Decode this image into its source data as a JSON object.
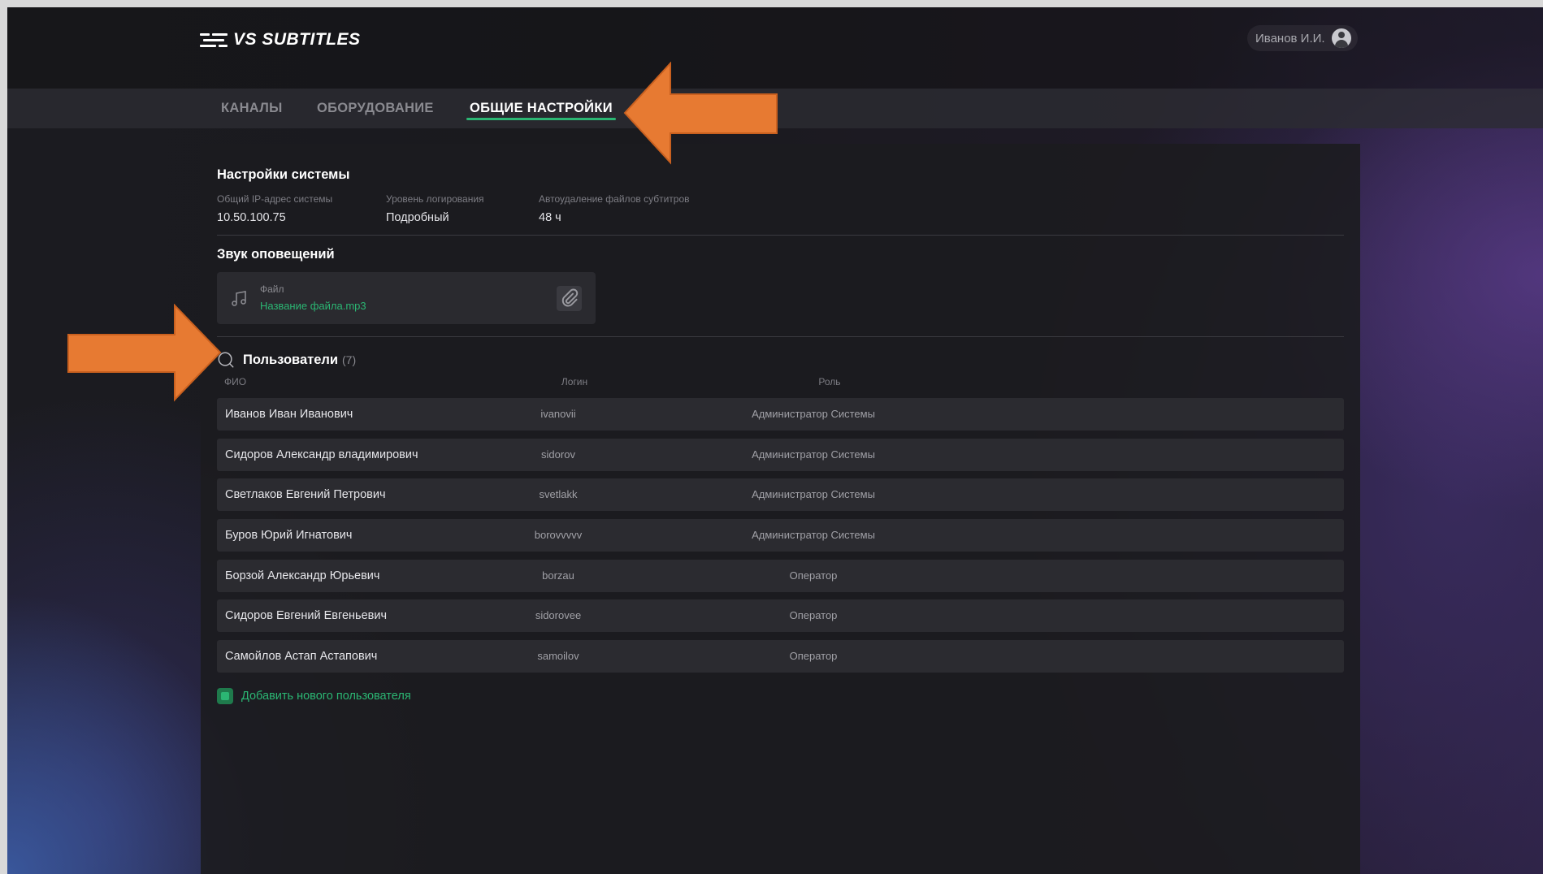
{
  "app": {
    "name": "VS SUBTITLES",
    "brand_color": "#2bb673",
    "accent_arrow_color": "#e77a32"
  },
  "header": {
    "user_name": "Иванов И.И.",
    "avatar_icon": "user-circle-icon"
  },
  "tabs": [
    {
      "label": "КАНАЛЫ",
      "active": false
    },
    {
      "label": "ОБОРУДОВАНИЕ",
      "active": false
    },
    {
      "label": "ОБЩИЕ НАСТРОЙКИ",
      "active": true
    }
  ],
  "system_settings": {
    "title": "Настройки системы",
    "fields": [
      {
        "label": "Общий IP-адрес системы",
        "value": "10.50.100.75"
      },
      {
        "label": "Уровень логирования",
        "value": "Подробный"
      },
      {
        "label": "Автоудаление файлов субтитров",
        "value": "48 ч"
      }
    ]
  },
  "notification_sound": {
    "title": "Звук оповещений",
    "file_label": "Файл",
    "file_name": "Название файла.mp3",
    "music_icon": "music-note-icon",
    "attach_icon": "paperclip-icon"
  },
  "users": {
    "title": "Пользователи",
    "count": "(7)",
    "search_icon": "search-icon",
    "columns": {
      "name": "ФИО",
      "login": "Логин",
      "role": "Роль"
    },
    "rows": [
      {
        "name": "Иванов Иван Иванович",
        "login": "ivanovii",
        "role": "Администратор Системы"
      },
      {
        "name": "Сидоров Александр владимирович",
        "login": "sidorov",
        "role": "Администратор Системы"
      },
      {
        "name": "Светлаков Евгений Петрович",
        "login": "svetlakk",
        "role": "Администратор Системы"
      },
      {
        "name": "Буров Юрий Игнатович",
        "login": "borovvvvv",
        "role": "Администратор Системы"
      },
      {
        "name": "Борзой Александр Юрьевич",
        "login": "borzau",
        "role": "Оператор"
      },
      {
        "name": "Сидоров Евгений Евгеньевич",
        "login": "sidorovee",
        "role": "Оператор"
      },
      {
        "name": "Самойлов Астап Астапович",
        "login": "samoilov",
        "role": "Оператор"
      }
    ],
    "add_label": "Добавить нового пользователя"
  }
}
